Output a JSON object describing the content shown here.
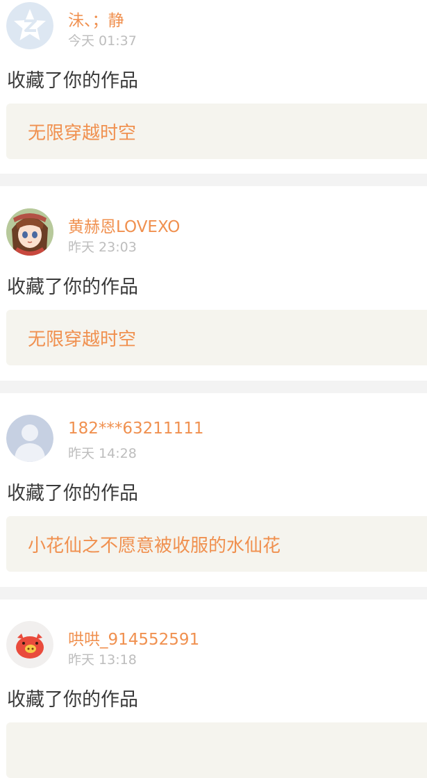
{
  "notifications": [
    {
      "username": "沬、；静",
      "time": "今天 01:37",
      "action": "收藏了你的作品",
      "work_title": "无限穿越时空",
      "avatar": "qzone-logo-avatar"
    },
    {
      "username": "黄赫恩LOVEXO",
      "time": "昨天 23:03",
      "action": "收藏了你的作品",
      "work_title": "无限穿越时空",
      "avatar": "anime-girl-avatar"
    },
    {
      "username": "182***63211111",
      "time": "昨天 14:28",
      "action": "收藏了你的作品",
      "work_title": "小花仙之不愿意被收服的水仙花",
      "avatar": "default-person-avatar"
    },
    {
      "username": "哄哄_914552591",
      "time": "昨天 13:18",
      "action": "收藏了你的作品",
      "work_title": "",
      "avatar": "red-pig-avatar"
    }
  ],
  "colors": {
    "username": "#f0904f",
    "work_title": "#f0904f",
    "time": "#bdbdbd",
    "action": "#3a3a3a",
    "work_box_bg": "#f5f4ee",
    "separator": "#f3f3f3"
  }
}
